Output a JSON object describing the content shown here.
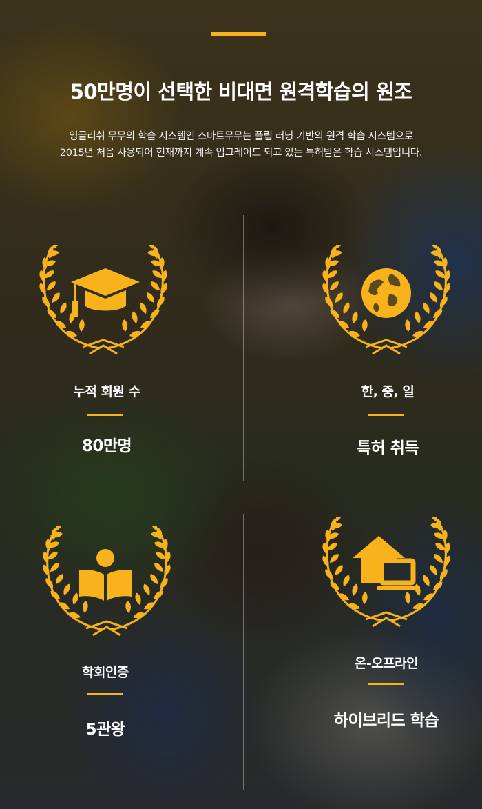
{
  "headline": "50만명이 선택한 비대면 원격학습의 원조",
  "description": {
    "line1": "잉글리쉬 무무의 학습 시스템인 스마트무무는 플립 러닝 기반의 원격 학습 시스템으로",
    "line2": "2015년 처음 사용되어 현재까지 계속 업그레이드 되고 있는 특허받은 학습 시스템입니다."
  },
  "colors": {
    "accent": "#f7b21c",
    "text": "#ffffff"
  },
  "stats": [
    {
      "icon": "graduation-cap-icon",
      "label": "누적 회원 수",
      "value": "80만명"
    },
    {
      "icon": "globe-icon",
      "label": "한, 중, 일",
      "value": "특허 취득"
    },
    {
      "icon": "reading-person-icon",
      "label": "학회인증",
      "value": "5관왕"
    },
    {
      "icon": "home-laptop-icon",
      "label": "온-오프라인",
      "value": "하이브리드 학습"
    }
  ]
}
